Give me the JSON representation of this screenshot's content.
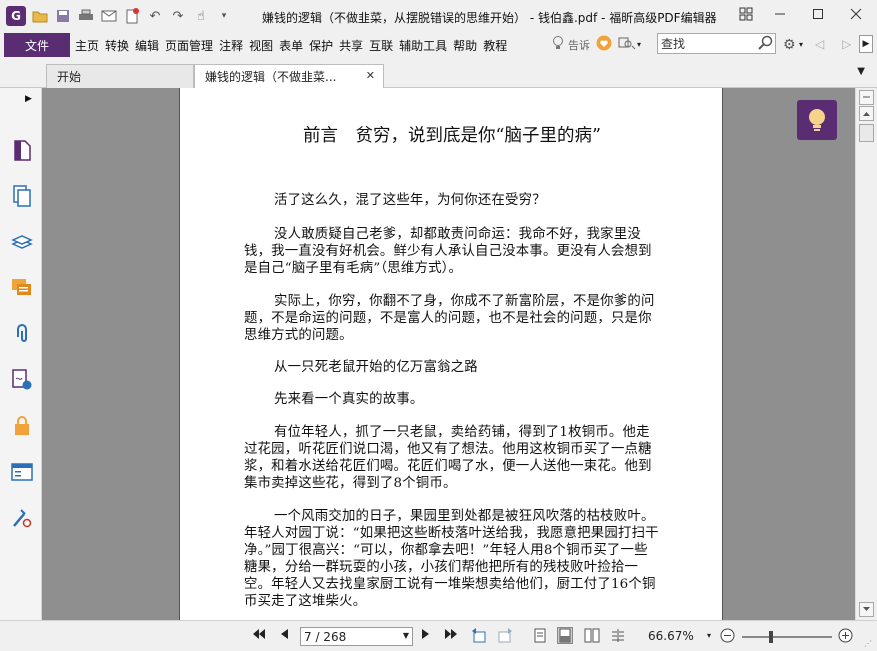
{
  "window": {
    "title": "嫌钱的逻辑（不做韭菜，从摆脱错误的思维开始） - 钱伯鑫.pdf - 福昕高级PDF编辑器",
    "app_logo": "G"
  },
  "menubar": {
    "file": "文件",
    "items": [
      "主页",
      "转换",
      "编辑",
      "页面管理",
      "注释",
      "视图",
      "表单",
      "保护",
      "共享",
      "互联",
      "辅助工具",
      "帮助",
      "教程"
    ],
    "tell_me": "告诉",
    "search_placeholder": "查找"
  },
  "tabs": [
    {
      "label": "开始"
    },
    {
      "label": "嫌钱的逻辑（不做韭菜..."
    }
  ],
  "document": {
    "title": "前言　贫穷，说到底是你“脑子里的病”",
    "paragraphs": [
      "活了这么久，混了这些年，为何你还在受穷？",
      "没人敢质疑自己老爹，却都敢责问命运：我命不好，我家里没钱，我一直没有好机会。鲜少有人承认自己没本事。更没有人会想到是自己“脑子里有毛病”（思维方式）。",
      "实际上，你穷，你翻不了身，你成不了新富阶层，不是你爹的问题，不是命运的问题，不是富人的问题，也不是社会的问题，只是你思维方式的问题。",
      "从一只死老鼠开始的亿万富翁之路",
      "先来看一个真实的故事。",
      "有位年轻人，抓了一只老鼠，卖给药铺，得到了1枚铜币。他走过花园，听花匠们说口渴，他又有了想法。他用这枚铜币买了一点糖浆，和着水送给花匠们喝。花匠们喝了水，便一人送他一束花。他到集市卖掉这些花，得到了8个铜币。",
      "一个风雨交加的日子，果园里到处都是被狂风吹落的枯枝败叶。年轻人对园丁说：“如果把这些断枝落叶送给我，我愿意把果园打扫干净。”园丁很高兴：“可以，你都拿去吧！”年轻人用8个铜币买了一些糖果，分给一群玩耍的小孩，小孩们帮他把所有的残枝败叶捡拾一空。年轻人又去找皇家厨工说有一堆柴想卖给他们，厨工付了16个铜币买走了这堆柴火。"
    ]
  },
  "statusbar": {
    "page_indicator": "7 / 268",
    "zoom": "66.67%"
  },
  "colors": {
    "brand": "#5a2d73"
  }
}
